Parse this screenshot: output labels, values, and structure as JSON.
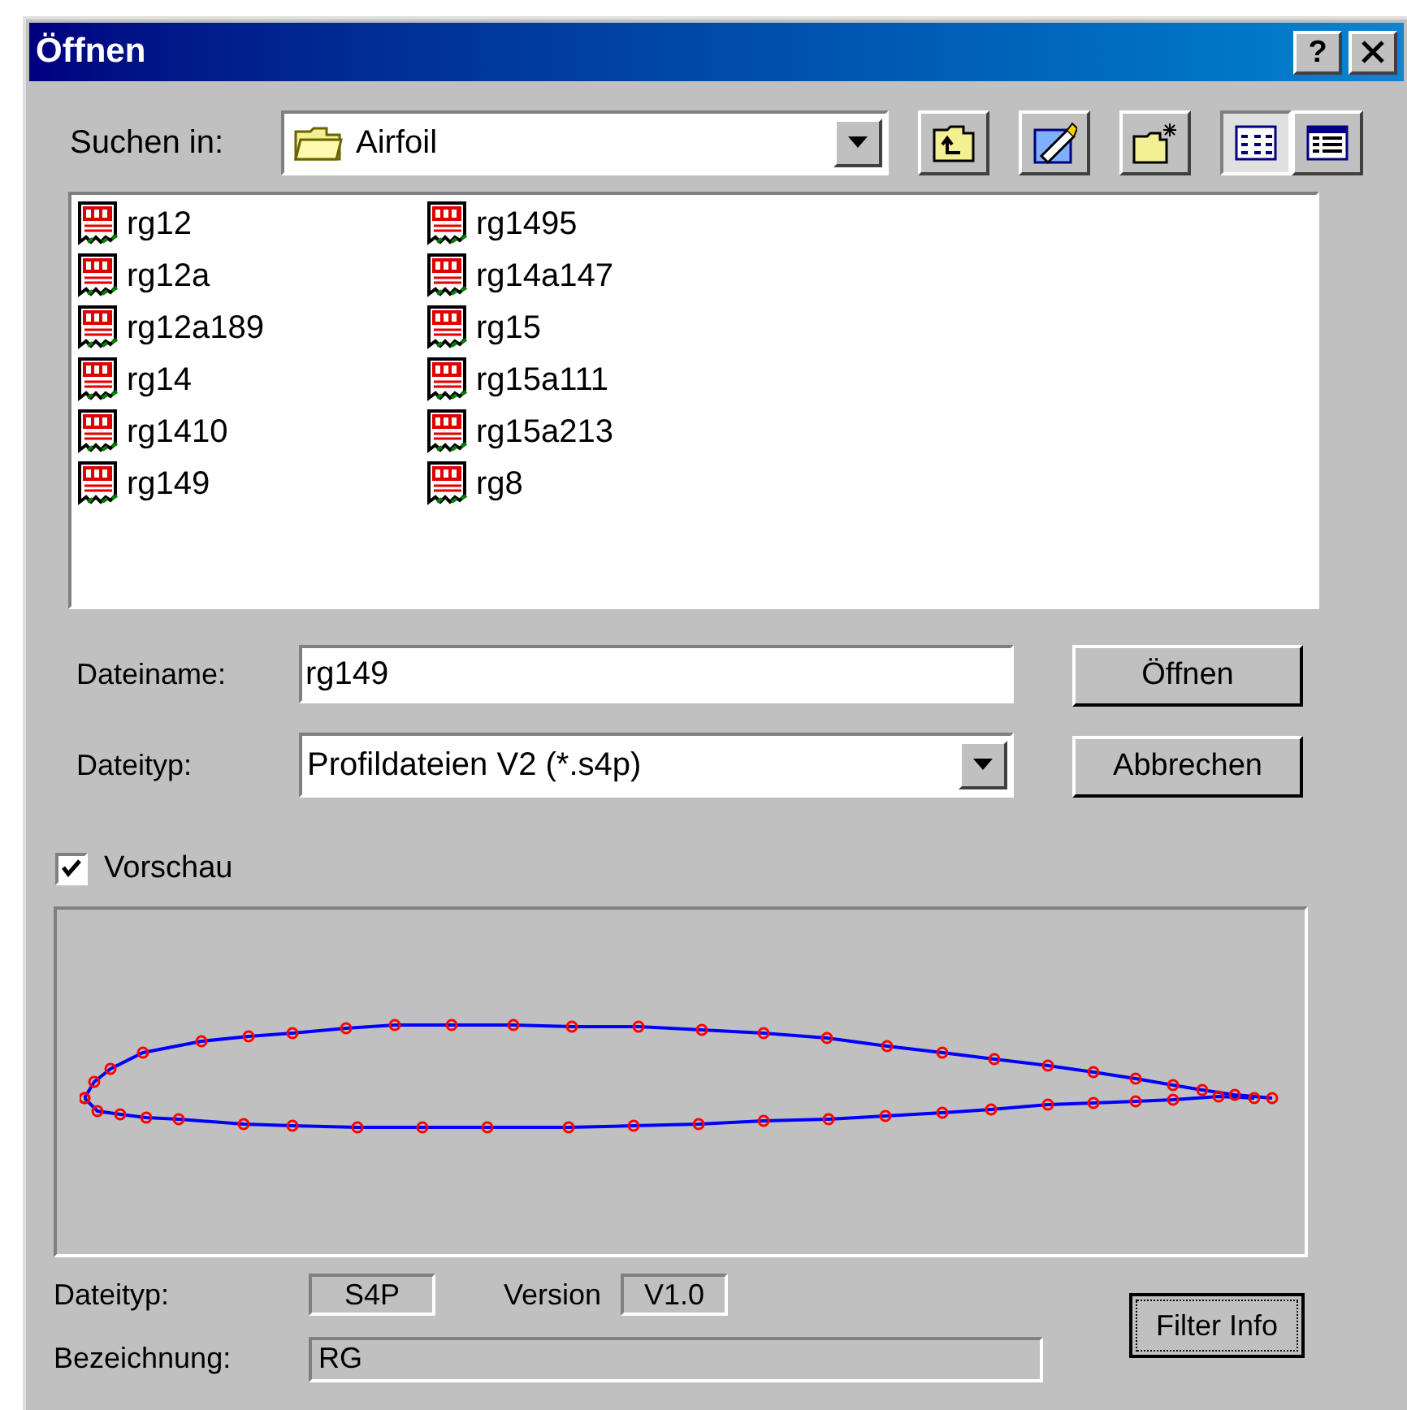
{
  "window": {
    "title": "Öffnen",
    "help": "?"
  },
  "look_in": {
    "label": "Suchen in:",
    "value": "Airfoil"
  },
  "view_buttons": [
    {
      "kind": "list",
      "selected": true
    },
    {
      "kind": "details",
      "selected": false
    }
  ],
  "files": [
    "rg12",
    "rg12a",
    "rg12a189",
    "rg14",
    "rg1410",
    "rg149",
    "rg1495",
    "rg14a147",
    "rg15",
    "rg15a111",
    "rg15a213",
    "rg8"
  ],
  "file_name": {
    "label": "Dateiname:",
    "value": "rg149"
  },
  "file_type": {
    "label": "Dateityp:",
    "value": "Profildateien V2 (*.s4p)"
  },
  "buttons": [
    "Öffnen",
    "Abbrechen"
  ],
  "preview": {
    "label": "Vorschau",
    "checked": true
  },
  "info": {
    "type_label": "Dateityp:",
    "type_value": "S4P",
    "version_label": "Version",
    "version_value": "V1.0",
    "desc_label": "Bezeichnung:",
    "desc_value": "RG"
  },
  "filter_button": "Filter Info"
}
